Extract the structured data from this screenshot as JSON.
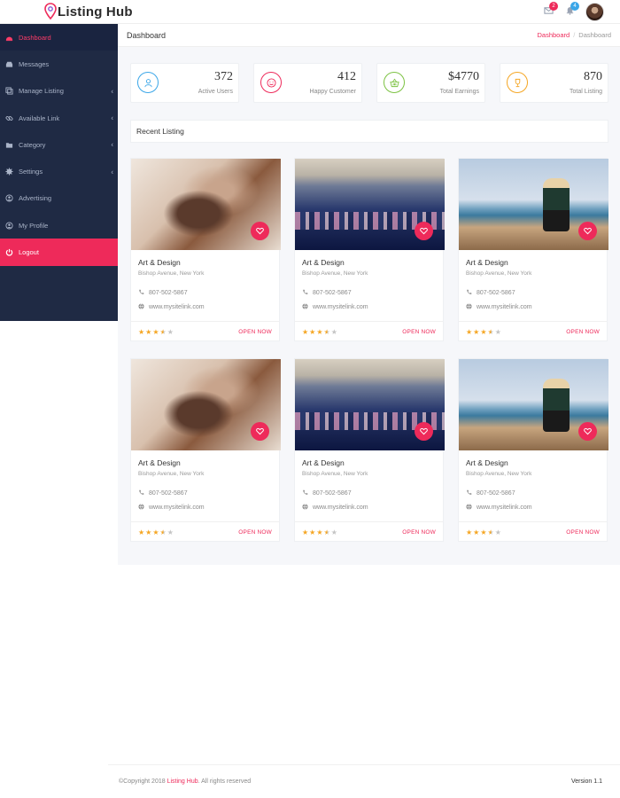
{
  "brand": {
    "name": "Listing Hub",
    "accent": "#ee2a5a"
  },
  "header": {
    "mail_badge": "2",
    "notif_badge": "4"
  },
  "sidebar": {
    "items": [
      {
        "label": "Dashboard",
        "icon": "dashboard-icon",
        "active": true
      },
      {
        "label": "Messages",
        "icon": "inbox-icon"
      },
      {
        "label": "Manage Listing",
        "icon": "copy-icon",
        "chevron": true
      },
      {
        "label": "Available Link",
        "icon": "link-icon",
        "chevron": true
      },
      {
        "label": "Category",
        "icon": "folder-icon",
        "chevron": true
      },
      {
        "label": "Settings",
        "icon": "gear-icon",
        "chevron": true
      },
      {
        "label": "Advertising",
        "icon": "target-icon"
      },
      {
        "label": "My Profile",
        "icon": "user-circle-icon"
      },
      {
        "label": "Logout",
        "icon": "power-icon"
      }
    ]
  },
  "page": {
    "title": "Dashboard",
    "breadcrumb": [
      "Dashboard",
      "Dashboard"
    ]
  },
  "stats": [
    {
      "value": "372",
      "label": "Active Users",
      "color": "#3aa6e8",
      "icon": "user-icon"
    },
    {
      "value": "412",
      "label": "Happy Customer",
      "color": "#ee2a5a",
      "icon": "smile-icon"
    },
    {
      "value": "$4770",
      "label": "Total Earnings",
      "color": "#7cc242",
      "icon": "basket-icon"
    },
    {
      "value": "870",
      "label": "Total Listing",
      "color": "#f5a623",
      "icon": "trophy-icon"
    }
  ],
  "recent": {
    "title": "Recent Listing"
  },
  "listings": [
    {
      "title": "Art & Design",
      "address": "Bishop Avenue, New York",
      "phone": "807-502-5867",
      "website": "www.mysitelink.com",
      "rating": 3.5,
      "cta": "OPEN NOW",
      "image": "art"
    },
    {
      "title": "Art & Design",
      "address": "Bishop Avenue, New York",
      "phone": "807-502-5867",
      "website": "www.mysitelink.com",
      "rating": 3.5,
      "cta": "OPEN NOW",
      "image": "conf"
    },
    {
      "title": "Art & Design",
      "address": "Bishop Avenue, New York",
      "phone": "807-502-5867",
      "website": "www.mysitelink.com",
      "rating": 3.5,
      "cta": "OPEN NOW",
      "image": "beach"
    },
    {
      "title": "Art & Design",
      "address": "Bishop Avenue, New York",
      "phone": "807-502-5867",
      "website": "www.mysitelink.com",
      "rating": 3.5,
      "cta": "OPEN NOW",
      "image": "art"
    },
    {
      "title": "Art & Design",
      "address": "Bishop Avenue, New York",
      "phone": "807-502-5867",
      "website": "www.mysitelink.com",
      "rating": 3.5,
      "cta": "OPEN NOW",
      "image": "conf"
    },
    {
      "title": "Art & Design",
      "address": "Bishop Avenue, New York",
      "phone": "807-502-5867",
      "website": "www.mysitelink.com",
      "rating": 3.5,
      "cta": "OPEN NOW",
      "image": "beach"
    }
  ],
  "footer": {
    "copy_prefix": "©Copyright 2018 ",
    "copy_brand": "Listing Hub",
    "copy_suffix": ". All rights reserved",
    "version": "Version 1.1"
  }
}
